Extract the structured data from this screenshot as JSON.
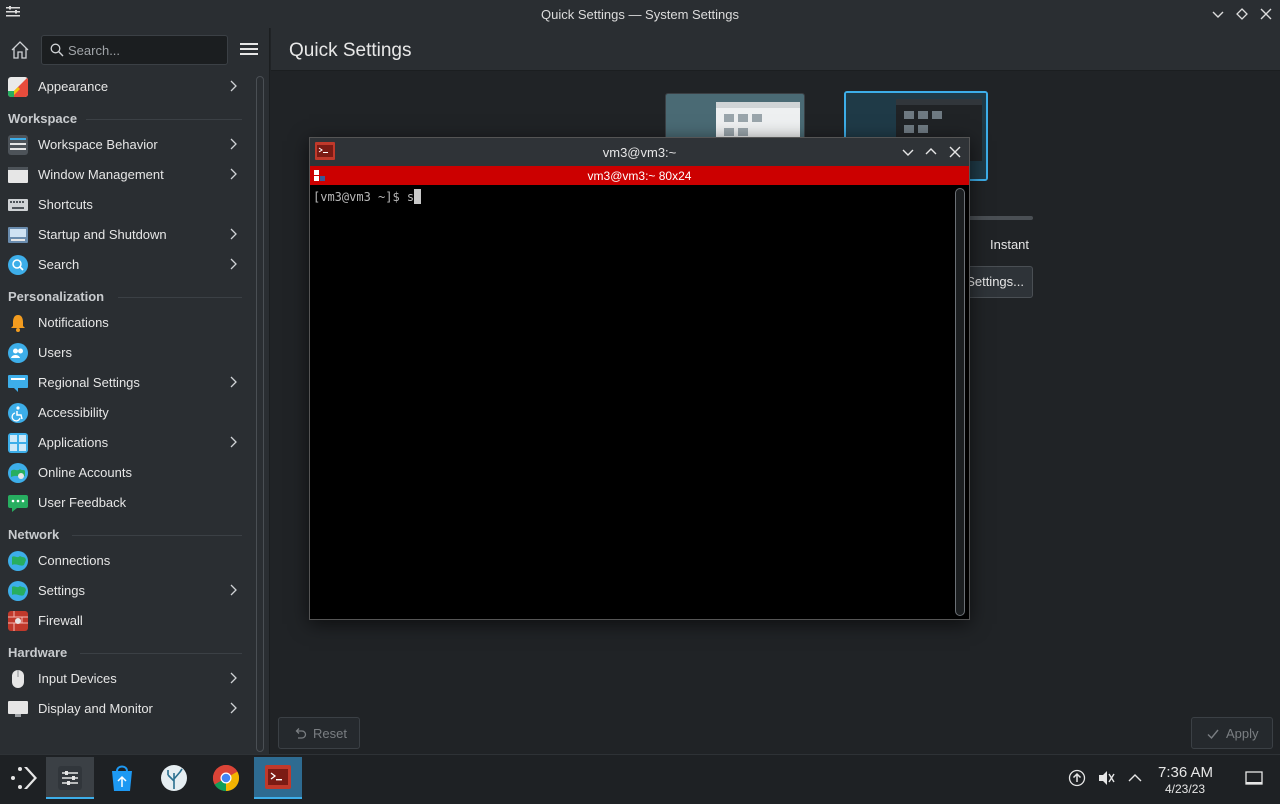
{
  "window": {
    "title": "Quick Settings — System Settings"
  },
  "search": {
    "placeholder": "Search..."
  },
  "page": {
    "title": "Quick Settings"
  },
  "sidebar": {
    "top_item": {
      "label": "Appearance",
      "icon": "appearance-icon"
    },
    "groups": [
      {
        "heading": "Workspace",
        "items": [
          {
            "label": "Workspace Behavior",
            "icon": "workspace-behavior-icon",
            "chevron": true
          },
          {
            "label": "Window Management",
            "icon": "window-management-icon",
            "chevron": true
          },
          {
            "label": "Shortcuts",
            "icon": "keyboard-icon",
            "chevron": false
          },
          {
            "label": "Startup and Shutdown",
            "icon": "startup-icon",
            "chevron": true
          },
          {
            "label": "Search",
            "icon": "search-icon",
            "chevron": true
          }
        ]
      },
      {
        "heading": "Personalization",
        "items": [
          {
            "label": "Notifications",
            "icon": "bell-icon",
            "chevron": false
          },
          {
            "label": "Users",
            "icon": "users-icon",
            "chevron": false
          },
          {
            "label": "Regional Settings",
            "icon": "regional-icon",
            "chevron": true
          },
          {
            "label": "Accessibility",
            "icon": "accessibility-icon",
            "chevron": false
          },
          {
            "label": "Applications",
            "icon": "applications-icon",
            "chevron": true
          },
          {
            "label": "Online Accounts",
            "icon": "online-accounts-icon",
            "chevron": false
          },
          {
            "label": "User Feedback",
            "icon": "feedback-icon",
            "chevron": false
          }
        ]
      },
      {
        "heading": "Network",
        "items": [
          {
            "label": "Connections",
            "icon": "globe-icon",
            "chevron": false
          },
          {
            "label": "Settings",
            "icon": "globe-icon",
            "chevron": true
          },
          {
            "label": "Firewall",
            "icon": "firewall-icon",
            "chevron": false
          }
        ]
      },
      {
        "heading": "Hardware",
        "items": [
          {
            "label": "Input Devices",
            "icon": "mouse-icon",
            "chevron": true
          },
          {
            "label": "Display and Monitor",
            "icon": "monitor-icon",
            "chevron": true
          }
        ]
      }
    ]
  },
  "content": {
    "animation_speed_label": "Instant",
    "settings_button_label": "Settings..."
  },
  "footer": {
    "reset_label": "Reset",
    "apply_label": "Apply"
  },
  "terminal": {
    "title": "vm3@vm3:~",
    "tab_label": "vm3@vm3:~ 80x24",
    "prompt": "[vm3@vm3 ~]$ s"
  },
  "taskbar": {
    "apps": [
      "application-launcher-icon",
      "system-settings-icon",
      "discover-store-icon",
      "coral-app-icon",
      "chrome-icon",
      "terminal-icon"
    ],
    "clock_time": "7:36 AM",
    "clock_date": "4/23/23"
  },
  "colors": {
    "accent": "#3daee9",
    "terminal_tab": "#cc0000",
    "window_bg": "#2a2e32",
    "content_bg": "#202326"
  }
}
